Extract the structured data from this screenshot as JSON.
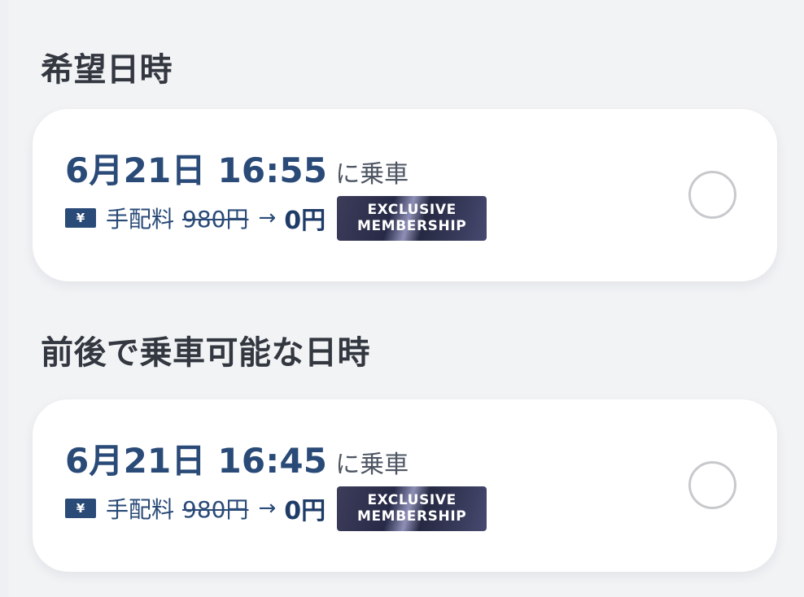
{
  "sections": [
    {
      "title": "希望日時",
      "option": {
        "date_time": "6月21日 16:55",
        "boarding_label": "に乗車",
        "currency_icon": "¥",
        "fee_label": "手配料",
        "fee_original": "980円",
        "fee_arrow": "→",
        "fee_discounted": "0円",
        "badge_line_1": "EXCLUSIVE",
        "badge_line_2": "MEMBERSHIP",
        "selected": false
      }
    },
    {
      "title": "前後で乗車可能な日時",
      "option": {
        "date_time": "6月21日 16:45",
        "boarding_label": "に乗車",
        "currency_icon": "¥",
        "fee_label": "手配料",
        "fee_original": "980円",
        "fee_arrow": "→",
        "fee_discounted": "0円",
        "badge_line_1": "EXCLUSIVE",
        "badge_line_2": "MEMBERSHIP",
        "selected": false
      }
    }
  ],
  "colors": {
    "accent_navy": "#2a4a78",
    "page_background": "#f2f3f5",
    "card_background": "#ffffff",
    "radio_border": "#c7c9cd"
  },
  "icons": {
    "currency": "yen-icon",
    "selector": "radio-unselected-icon"
  }
}
